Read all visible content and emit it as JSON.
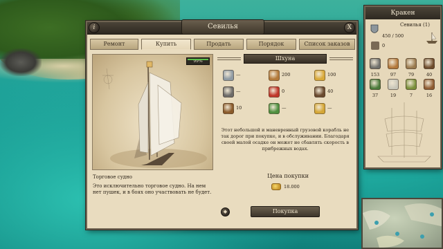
{
  "main_window": {
    "title": "Севилья",
    "info_label": "i",
    "close_label": "X",
    "tabs": [
      "Ремонт",
      "Купить",
      "Продать",
      "Порядок",
      "Список заказов"
    ],
    "active_tab": 1,
    "ship_view": {
      "hp_text": "99%",
      "hp_fraction": 0.99
    },
    "ship_name": "Торговое судно",
    "ship_description": "Это исключительно торговое судно. На нем нет пушек, и в боях оно участвовать не будет.",
    "stats_header": "Шхуна",
    "stats": [
      {
        "icon": "hull-icon",
        "value": "—",
        "color": "#8f9aa3"
      },
      {
        "icon": "cargo-chest-icon",
        "value": "200",
        "color": "#b37a3b"
      },
      {
        "icon": "gold-coins-icon",
        "value": "100",
        "color": "#d9a93a"
      },
      {
        "icon": "cannon-icon",
        "value": "—",
        "color": "#6d6b68"
      },
      {
        "icon": "anchor-icon",
        "value": "0",
        "color": "#c0382b"
      },
      {
        "icon": "crew-icon",
        "value": "40",
        "color": "#6a4a2f"
      },
      {
        "icon": "helm-icon",
        "value": "10",
        "color": "#8a5a2a"
      },
      {
        "icon": "speed-arrows-icon",
        "value": "—",
        "color": "#4f8f3f"
      },
      {
        "icon": "turn-icon",
        "value": "—",
        "color": "#d4a636"
      }
    ],
    "ship_text": "Этот небольшой и маневренный грузовой корабль не так дорог при покупке, и в обслуживании. Благодаря своей малой осадке он может не сбавлять скорость в прибрежных водах.",
    "price_label": "Цена покупки",
    "price_value": "18.000",
    "buy_button": "Покупка",
    "nav_label": "◆"
  },
  "fleet_panel": {
    "title": "Кракен",
    "ship_name": "Севилья (1)",
    "hull_value": "450 / 500",
    "crew_value": "0",
    "slots_row1": [
      {
        "icon": "cannon-slot-icon",
        "value": "153",
        "color": "#70706c"
      },
      {
        "icon": "cargo-slot-icon",
        "value": "97",
        "color": "#b3783a"
      },
      {
        "icon": "crate-slot-icon",
        "value": "79",
        "color": "#9a7a4e"
      },
      {
        "icon": "rum-slot-icon",
        "value": "40",
        "color": "#6e4c2c"
      }
    ],
    "slots_row2": [
      {
        "icon": "food-slot-icon",
        "value": "37",
        "color": "#4a7a3a"
      },
      {
        "icon": "sugar-slot-icon",
        "value": "19",
        "color": "#c8c6b9"
      },
      {
        "icon": "tobacco-slot-icon",
        "value": "7",
        "color": "#7a8f3a"
      },
      {
        "icon": "wood-slot-icon",
        "value": "16",
        "color": "#8e5b31"
      }
    ]
  },
  "minimap": {
    "label": "map"
  }
}
